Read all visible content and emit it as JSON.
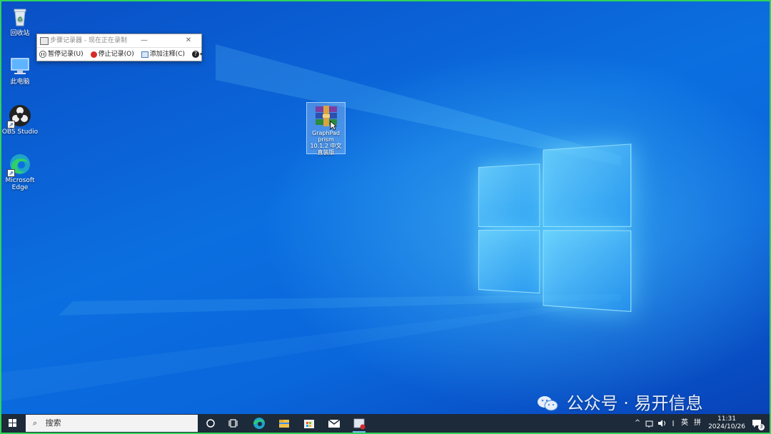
{
  "desktop": {
    "icons": [
      {
        "label": "回收站",
        "icon": "recycle-bin-icon"
      },
      {
        "label": "此电脑",
        "icon": "this-pc-icon"
      },
      {
        "label": "OBS Studio",
        "icon": "obs-icon"
      },
      {
        "label": "Microsoft Edge",
        "icon": "edge-icon"
      }
    ],
    "file": {
      "label": "GraphPad prism 10.1.2 中文直装版",
      "icon": "winrar-archive-icon"
    }
  },
  "steps_recorder": {
    "title": "步骤记录器 - 现在正在录制",
    "pause_label": "暂停记录(U)",
    "stop_label": "停止记录(O)",
    "comment_label": "添加注释(C)",
    "help_symbol": "?"
  },
  "taskbar": {
    "search_placeholder": "搜索",
    "pinned": [
      "task-view-icon",
      "edge-icon",
      "file-explorer-icon",
      "store-icon",
      "mail-icon",
      "steps-recorder-icon"
    ],
    "tray": {
      "lang": "英",
      "ime": "拼",
      "time": "11:31",
      "date": "2024/10/26",
      "notifications": "3"
    }
  },
  "watermark": {
    "text": "公众号 · 易开信息",
    "icon": "wechat-icon"
  }
}
